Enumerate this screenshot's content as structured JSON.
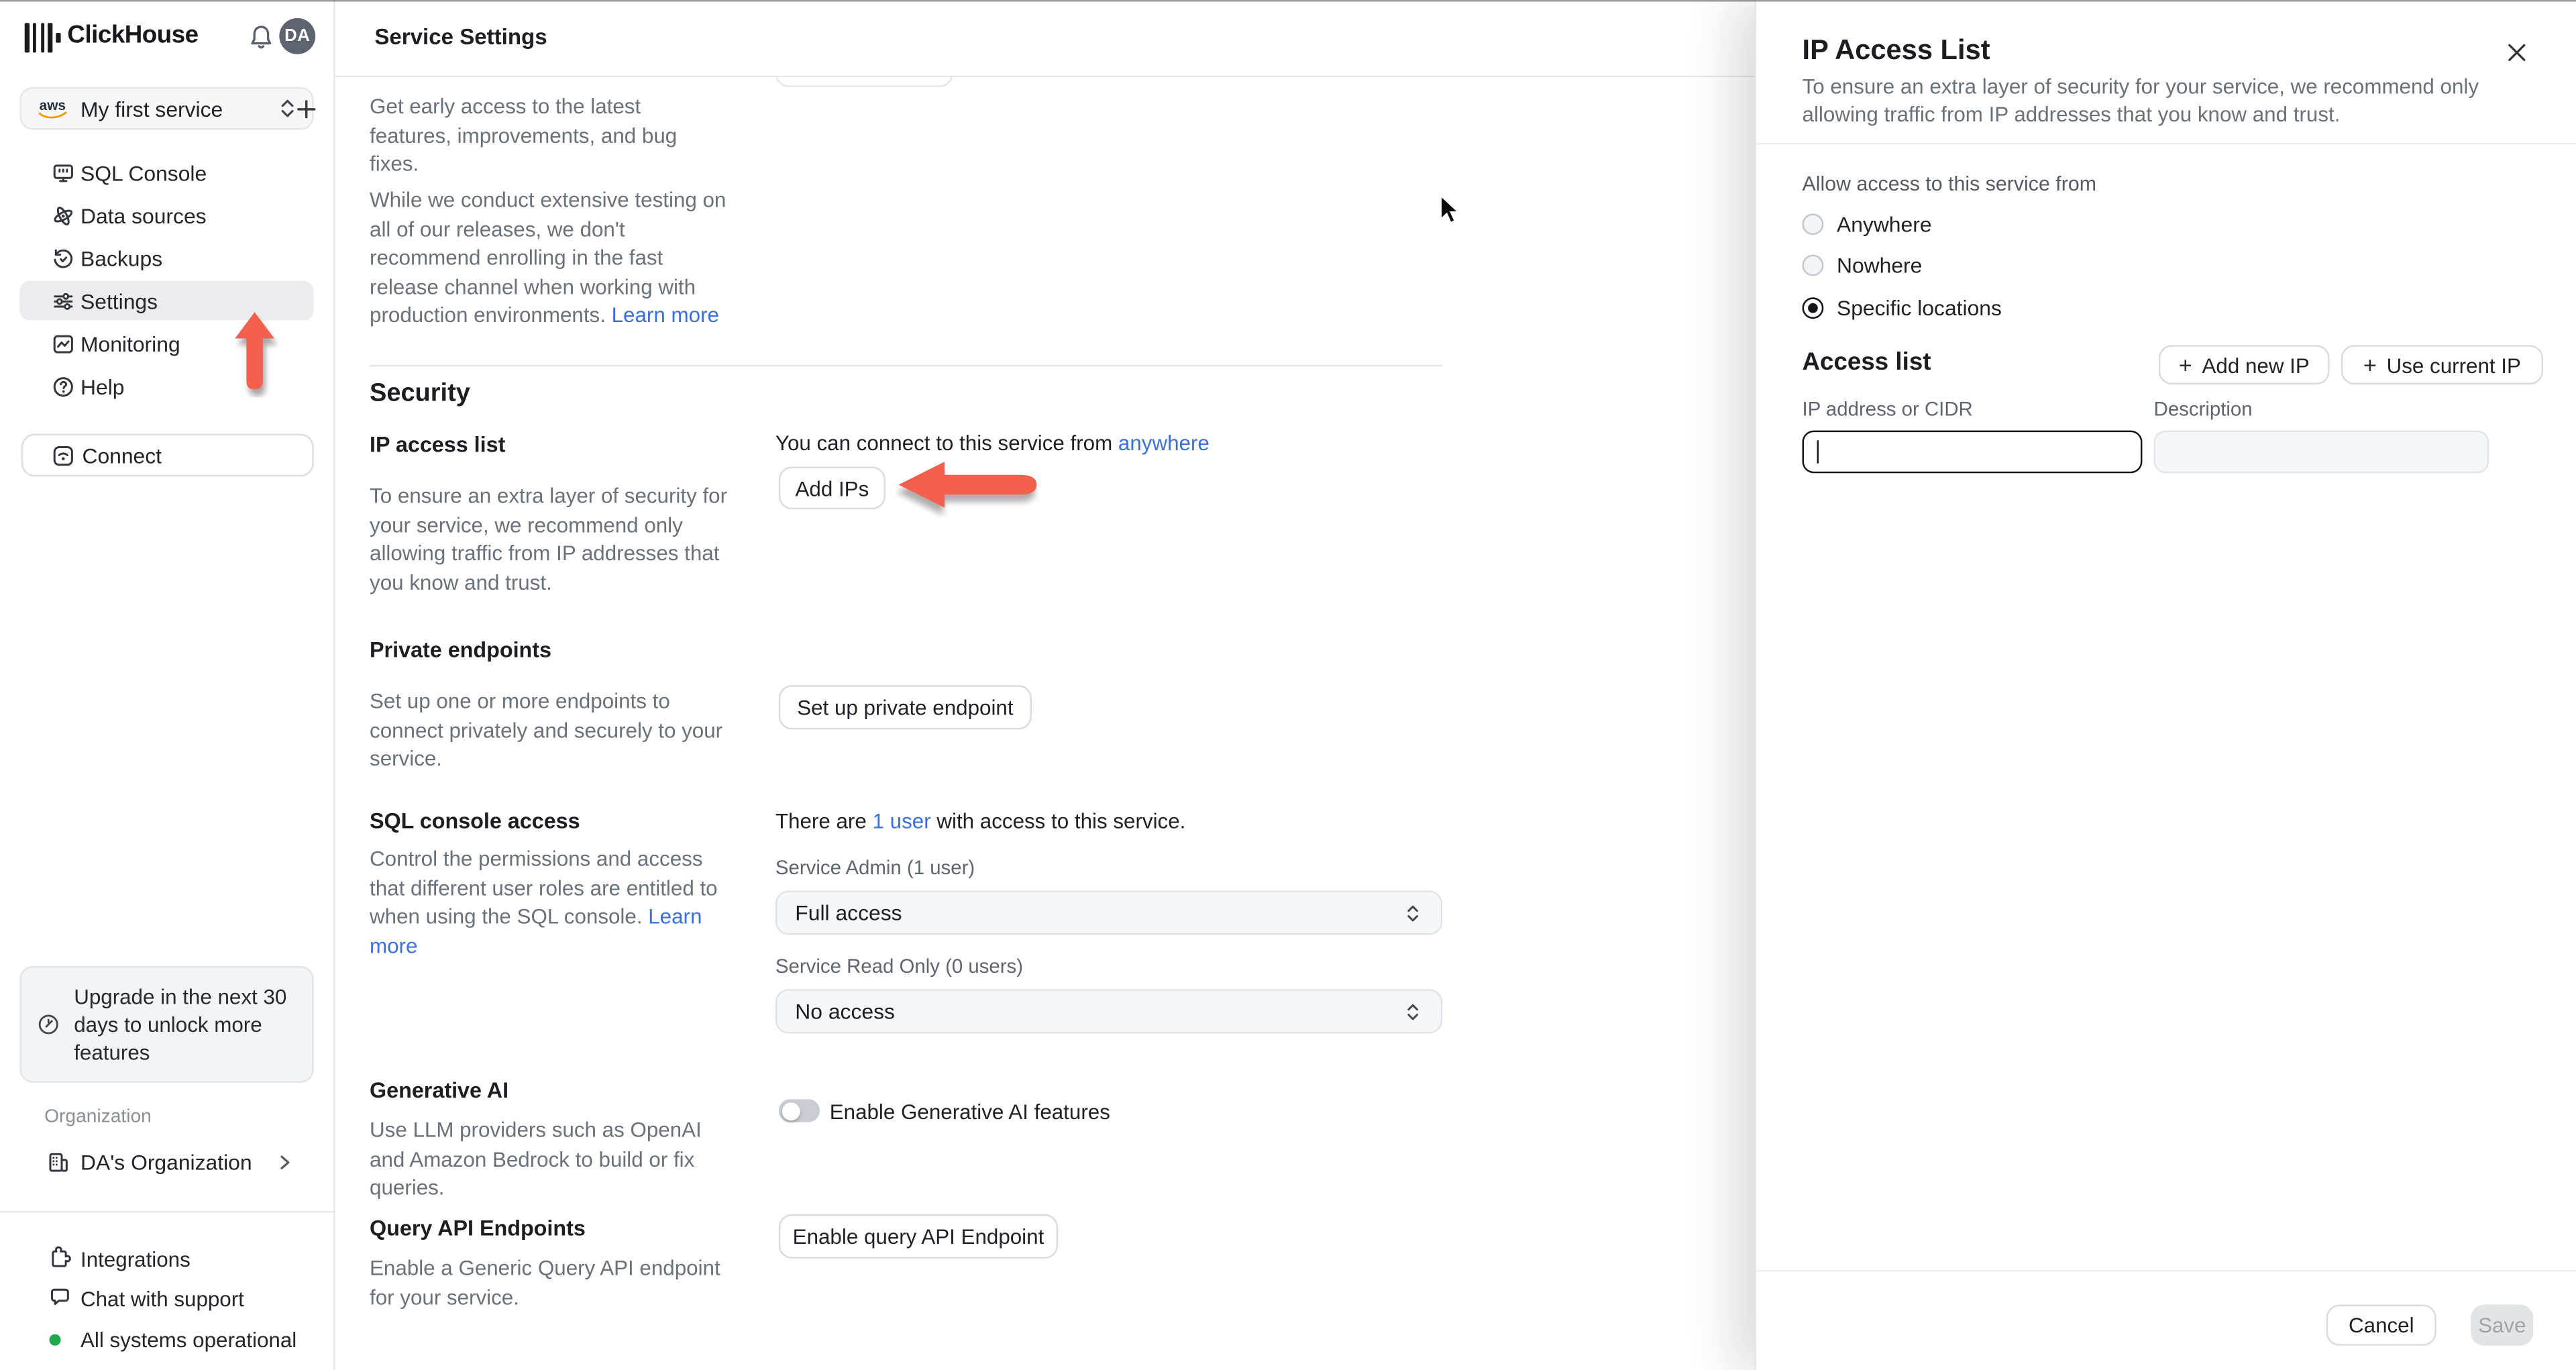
{
  "brand": {
    "name": "ClickHouse",
    "avatar_initials": "DA"
  },
  "service_selector": {
    "provider": "aws",
    "label": "My first service"
  },
  "sidebar": {
    "items": [
      {
        "label": "SQL Console"
      },
      {
        "label": "Data sources"
      },
      {
        "label": "Backups"
      },
      {
        "label": "Settings"
      },
      {
        "label": "Monitoring"
      },
      {
        "label": "Help"
      }
    ],
    "connect_label": "Connect",
    "upgrade_notice": "Upgrade in the next 30 days to unlock more features",
    "organization_label": "Organization",
    "organization_name": "DA's Organization",
    "footer": {
      "integrations": "Integrations",
      "chat": "Chat with support",
      "status": "All systems operational"
    }
  },
  "header": {
    "title": "Service Settings"
  },
  "release_channel": {
    "p1": "Get early access to the latest features, improvements, and bug fixes.",
    "p2": "While we conduct extensive testing on all of our releases, we don't recommend enrolling in the fast release channel when working with production environments. ",
    "learn_more": "Learn more"
  },
  "security": {
    "title": "Security",
    "ip_access": {
      "label": "IP access list",
      "connect_text": "You can connect to this service from ",
      "connect_link": "anywhere",
      "button": "Add IPs",
      "description": "To ensure an extra layer of security for your service, we recommend only allowing traffic from IP addresses that you know and trust."
    },
    "private_endpoints": {
      "label": "Private endpoints",
      "description": "Set up one or more endpoints to connect privately and securely to your service.",
      "button": "Set up private endpoint"
    },
    "sql_console": {
      "label": "SQL console access",
      "users_text_pre": "There are ",
      "users_link": "1 user",
      "users_text_post": " with access to this service.",
      "description": "Control the permissions and access that different user roles are entitled to when using the SQL console. ",
      "learn_more": "Learn more",
      "admin_label": "Service Admin (1 user)",
      "admin_value": "Full access",
      "readonly_label": "Service Read Only (0 users)",
      "readonly_value": "No access"
    },
    "generative_ai": {
      "label": "Generative AI",
      "toggle_label": "Enable Generative AI features",
      "toggle_state": "off",
      "description": "Use LLM providers such as OpenAI and Amazon Bedrock to build or fix queries."
    },
    "query_api": {
      "label": "Query API Endpoints",
      "button": "Enable query API Endpoint",
      "description": "Enable a Generic Query API endpoint for your service."
    }
  },
  "panel": {
    "title": "IP Access List",
    "description": "To ensure an extra layer of security for your service, we recommend only allowing traffic from IP addresses that you know and trust.",
    "allow_label": "Allow access to this service from",
    "options": [
      {
        "label": "Anywhere",
        "selected": false
      },
      {
        "label": "Nowhere",
        "selected": false
      },
      {
        "label": "Specific locations",
        "selected": true
      }
    ],
    "access_list": {
      "title": "Access list",
      "add_new_ip": "Add new IP",
      "use_current_ip": "Use current IP",
      "ip_label": "IP address or CIDR",
      "desc_label": "Description",
      "ip_value": "",
      "desc_value": ""
    },
    "cancel": "Cancel",
    "save": "Save"
  },
  "glyphs": {
    "plus": "+"
  },
  "colors": {
    "accent_red": "#F4604D",
    "link_blue": "#3B6FDB",
    "status_green": "#1FA94E"
  }
}
